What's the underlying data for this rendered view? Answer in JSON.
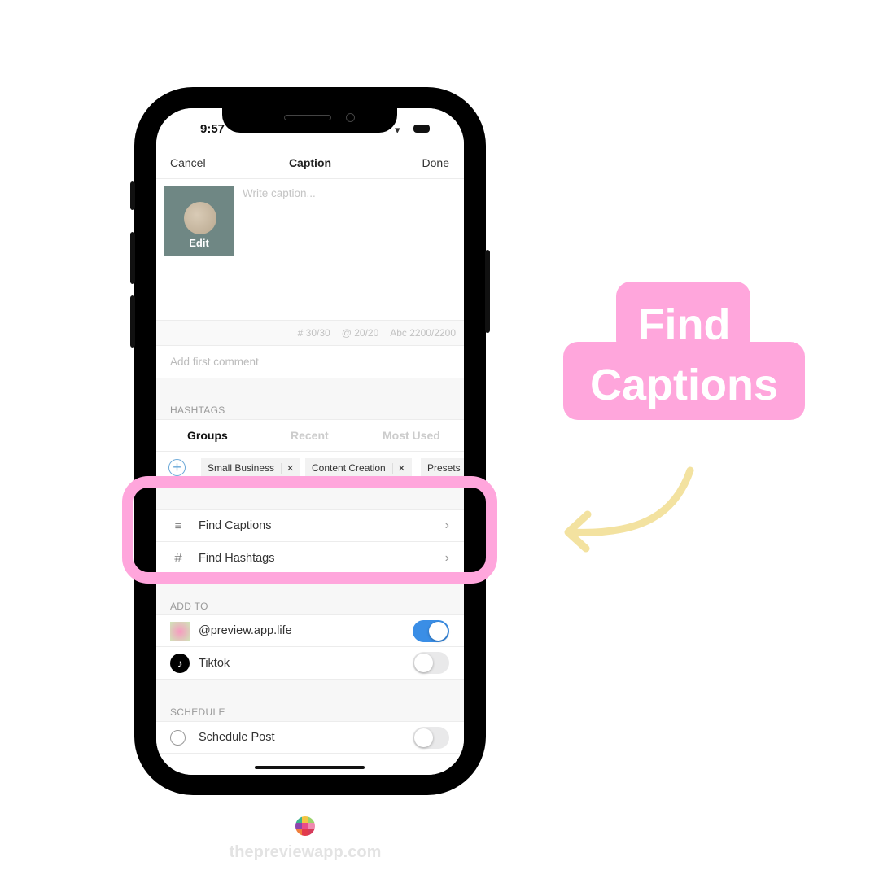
{
  "status": {
    "time": "9:57"
  },
  "nav": {
    "cancel": "Cancel",
    "title": "Caption",
    "done": "Done"
  },
  "caption": {
    "placeholder": "Write caption...",
    "thumb_label": "Edit"
  },
  "counters": {
    "hashtags": "# 30/30",
    "mentions": "@ 20/20",
    "chars": "Abc 2200/2200"
  },
  "comment": {
    "placeholder": "Add first comment"
  },
  "hashtags": {
    "section": "HASHTAGS",
    "tabs": [
      {
        "label": "Groups",
        "active": true
      },
      {
        "label": "Recent",
        "active": false
      },
      {
        "label": "Most Used",
        "active": false
      }
    ],
    "chips": [
      "Small Business",
      "Content Creation",
      "Presets"
    ]
  },
  "tools": [
    {
      "icon": "lines-icon",
      "label": "Find Captions"
    },
    {
      "icon": "hash-icon",
      "label": "Find Hashtags"
    }
  ],
  "add_to": {
    "section": "ADD TO",
    "accounts": [
      {
        "label": "@preview.app.life",
        "enabled": true
      },
      {
        "label": "Tiktok",
        "enabled": false
      }
    ]
  },
  "schedule": {
    "section": "SCHEDULE",
    "label": "Schedule Post",
    "enabled": false
  },
  "callout": {
    "line1": "Find",
    "line2": "Captions"
  },
  "footer": {
    "site": "thepreviewapp.com"
  },
  "colors": {
    "highlight": "#ffa6dc",
    "arrow": "#f3e2a0",
    "toggle_on": "#3a8ee6"
  }
}
